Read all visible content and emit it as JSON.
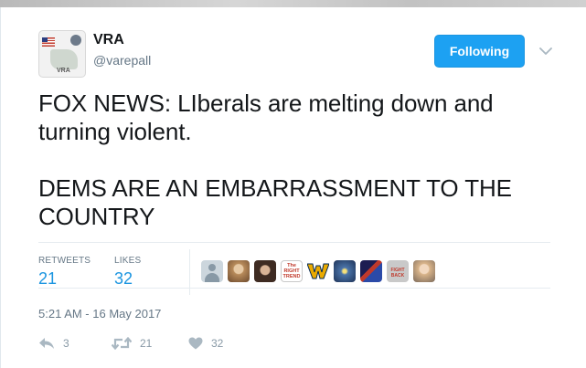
{
  "user": {
    "name": "VRA",
    "handle": "@varepall",
    "avatar_text": "VRA"
  },
  "follow_button": {
    "label": "Following"
  },
  "tweet": {
    "text": "FOX NEWS:  LIberals are melting down and\nturning violent.\n\nDEMS ARE AN EMBARRASSMENT TO THE\nCOUNTRY"
  },
  "stats": {
    "retweets_label": "RETWEETS",
    "retweets_count": "21",
    "likes_label": "LIKES",
    "likes_count": "32"
  },
  "favoriters": [
    {
      "icon": "default-avatar"
    },
    {
      "icon": "user-photo"
    },
    {
      "icon": "user-photo"
    },
    {
      "icon": "the-right-trend-logo",
      "text": "The RIGHT TREND"
    },
    {
      "icon": "wv-logo"
    },
    {
      "icon": "user-photo"
    },
    {
      "icon": "user-photo"
    },
    {
      "icon": "user-photo",
      "text": "FIGHT BACK"
    },
    {
      "icon": "user-photo"
    }
  ],
  "timestamp": "5:21 AM - 16 May 2017",
  "actions": {
    "reply_count": "3",
    "retweet_count": "21",
    "like_count": "32"
  },
  "colors": {
    "accent": "#1da1f2",
    "count_blue": "#1b95e0",
    "muted": "#657786",
    "icon_gray": "#8899a6",
    "wv_gold": "#eaaa00",
    "wv_blue": "#002855"
  }
}
